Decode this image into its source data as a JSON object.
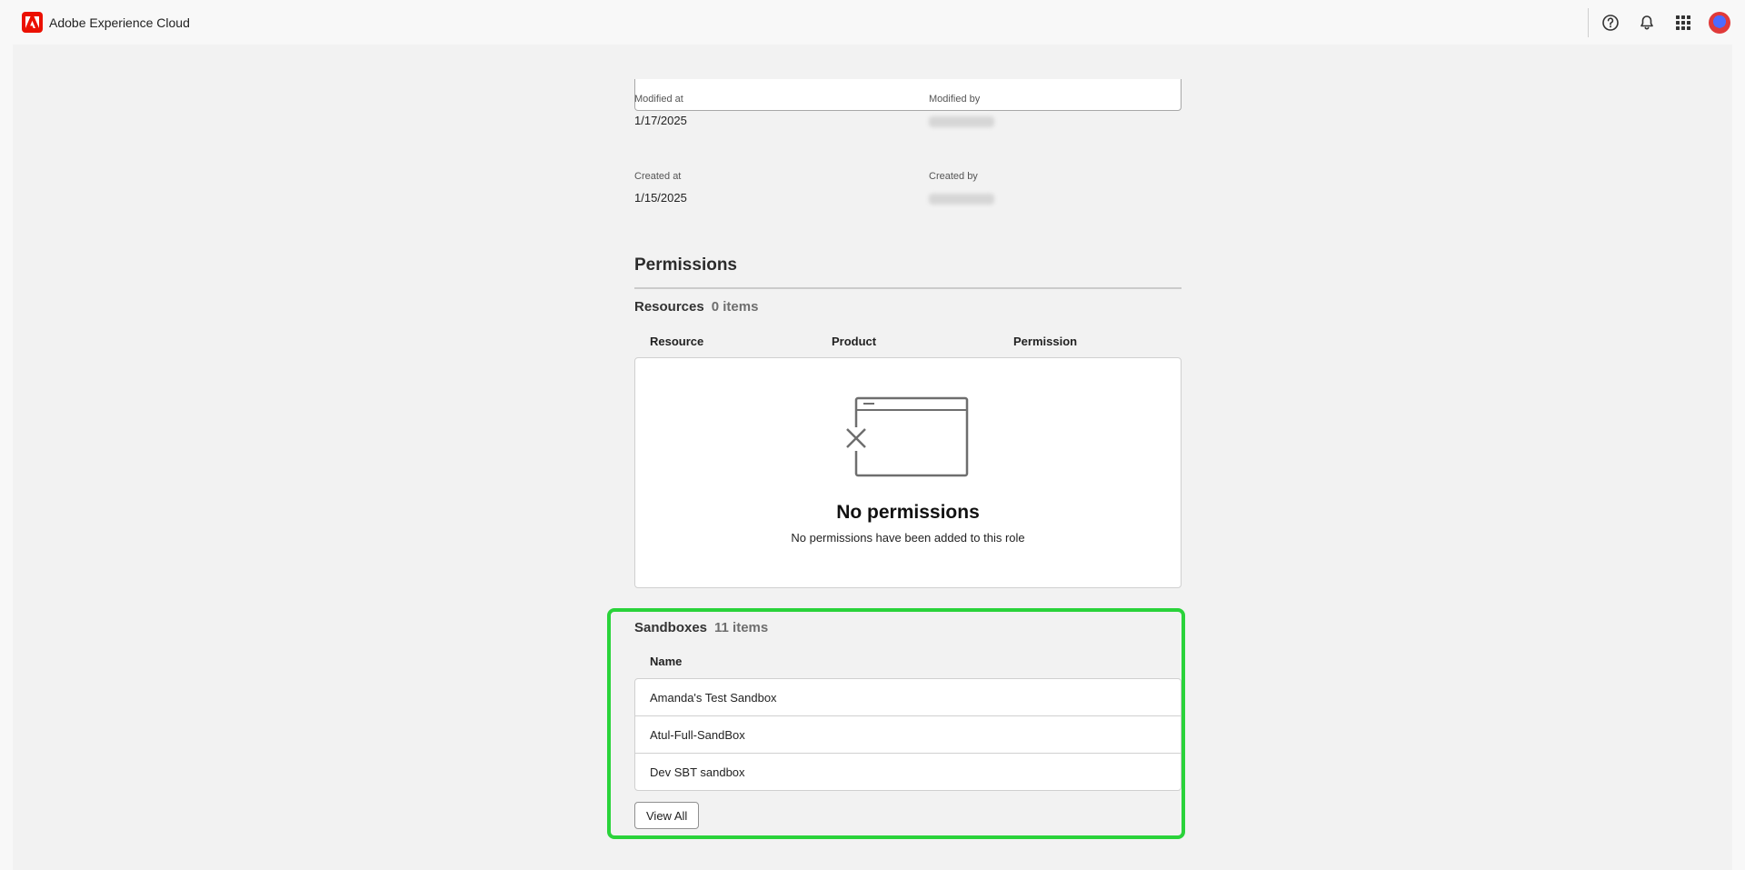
{
  "header": {
    "brand_name": "Adobe Experience Cloud",
    "brand_color": "#eb1000",
    "icons": [
      "help-icon",
      "bell-icon",
      "apps-grid-icon"
    ]
  },
  "details": {
    "modified_at_label": "Modified at",
    "modified_at_value": "1/17/2025",
    "modified_by_label": "Modified by",
    "created_at_label": "Created at",
    "created_at_value": "1/15/2025",
    "created_by_label": "Created by"
  },
  "permissions": {
    "title": "Permissions",
    "resources_label": "Resources",
    "resources_count": "0 items",
    "columns": [
      "Resource",
      "Product",
      "Permission"
    ],
    "empty_title": "No permissions",
    "empty_description": "No permissions have been added to this role"
  },
  "sandboxes": {
    "label": "Sandboxes",
    "count": "11 items",
    "column": "Name",
    "rows": [
      "Amanda's Test Sandbox",
      "Atul-Full-SandBox",
      "Dev SBT sandbox"
    ],
    "view_all_label": "View All",
    "highlight_color": "#2ad33a"
  }
}
